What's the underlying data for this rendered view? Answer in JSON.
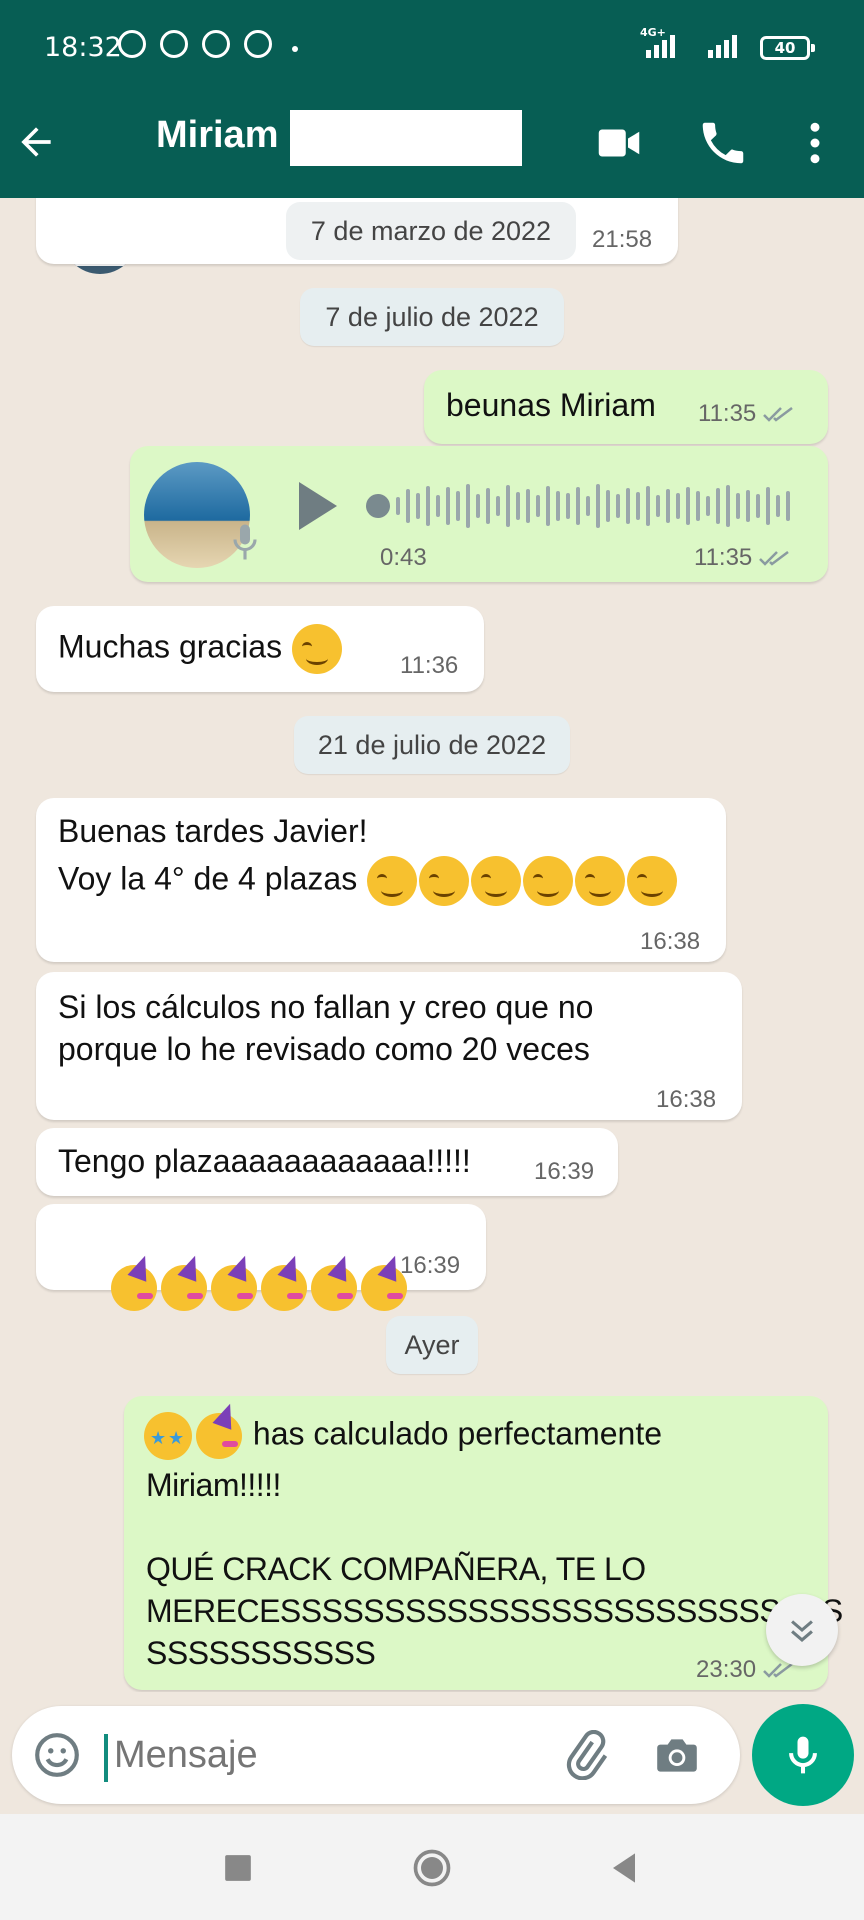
{
  "status_bar": {
    "time": "18:32",
    "network": "4G+",
    "battery": "40"
  },
  "header": {
    "contact_name": "Miriam"
  },
  "chat": {
    "partial_message": {
      "text": "7 de marzo de 2022",
      "time": "21:58"
    },
    "date_1": "7 de julio de 2022",
    "msg_1": {
      "text": "beunas Miriam",
      "time": "11:35"
    },
    "voice_1": {
      "duration": "0:43",
      "time": "11:35"
    },
    "msg_2": {
      "text": "Muchas gracias",
      "time": "11:36"
    },
    "date_2": "21 de julio de 2022",
    "msg_3": {
      "line1": "Buenas tardes Javier!",
      "line2": "Voy la 4° de 4 plazas",
      "time": "16:38"
    },
    "msg_4": {
      "text": "Si los cálculos no fallan y creo que no\nporque lo he revisado como 20 veces",
      "time": "16:38"
    },
    "msg_5": {
      "text": "Tengo plazaaaaaaaaaaaa!!!!!",
      "time": "16:39"
    },
    "msg_6": {
      "time": "16:39"
    },
    "date_3": "Ayer",
    "msg_7": {
      "line1": " has calculado perfectamente",
      "rest": "Miriam!!!!!\n\nQUÉ CRACK COMPAÑERA, TE LO\nMERECESSSSSSSSSSSSSSSSSSSSSSSSSSS\nSSSSSSSSSSS",
      "time": "23:30"
    }
  },
  "composer": {
    "placeholder": "Mensaje"
  },
  "colors": {
    "header": "#075e54",
    "outgoing": "#dcf8c6",
    "incoming": "#ffffff",
    "accent": "#00a884",
    "ticks": "#8a9aa0"
  },
  "icons": [
    "back-arrow-icon",
    "video-call-icon",
    "phone-icon",
    "more-icon",
    "emoji-icon",
    "attach-icon",
    "camera-icon",
    "mic-icon",
    "play-icon",
    "double-check-icon",
    "chevron-down-icon"
  ]
}
